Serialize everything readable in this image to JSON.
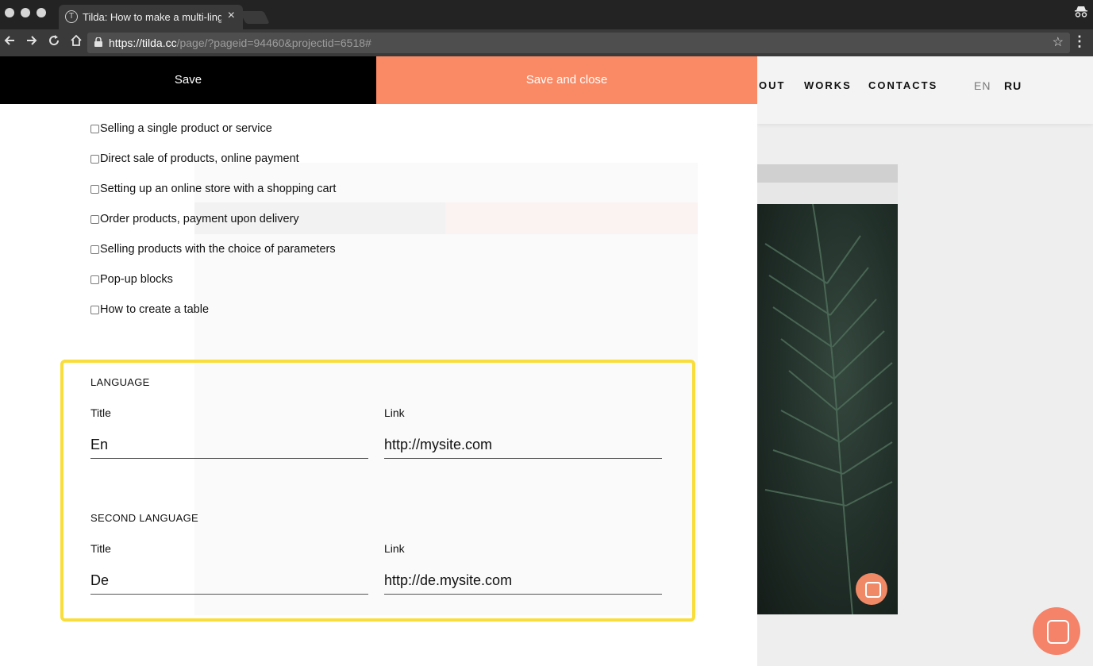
{
  "browser": {
    "tab_title": "Tilda: How to make a multi-lingual website",
    "tab_close": "×",
    "url_host": "https://tilda.cc",
    "url_path": "/page/?pageid=94460&projectid=6518#",
    "icons": [
      "back-icon",
      "forward-icon",
      "reload-icon",
      "home-icon",
      "lock-icon",
      "bookmark-star-icon",
      "menu-icon",
      "incognito-icon"
    ]
  },
  "editor": {
    "save_label": "Save",
    "save_close_label": "Save and close",
    "checkboxes": [
      "Selling a single product or service",
      "Direct sale of products, online payment",
      "Setting up an online store with a shopping cart",
      "Order products, payment upon delivery",
      "Selling products with the choice of parameters",
      "Pop-up blocks",
      "How to create a table"
    ],
    "language": {
      "section_label": "LANGUAGE",
      "title_label": "Title",
      "title_value": "En",
      "link_label": "Link",
      "link_value": "http://mysite.com"
    },
    "second_language": {
      "section_label": "SECOND LANGUAGE",
      "title_label": "Title",
      "title_value": "De",
      "link_label": "Link",
      "link_value": "http://de.mysite.com"
    },
    "highlight_color": "#f9dd3a",
    "accent_color": "#fa8a65"
  },
  "site": {
    "nav": [
      "OUT",
      "WORKS",
      "CONTACTS"
    ],
    "lang_en": "EN",
    "lang_ru": "RU"
  }
}
